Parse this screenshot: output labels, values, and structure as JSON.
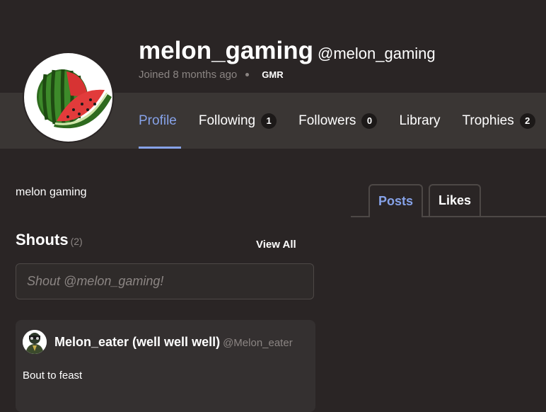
{
  "profile": {
    "display_name": "melon_gaming",
    "handle": "@melon_gaming",
    "joined": "Joined 8 months ago",
    "badge": "GMR",
    "bio": "melon gaming"
  },
  "nav": {
    "profile": "Profile",
    "following": "Following",
    "following_count": "1",
    "followers": "Followers",
    "followers_count": "0",
    "library": "Library",
    "trophies": "Trophies",
    "trophies_count": "2"
  },
  "shouts": {
    "title": "Shouts",
    "count": "(2)",
    "view_all": "View All",
    "placeholder": "Shout @melon_gaming!",
    "items": [
      {
        "author": "Melon_eater (well well well)",
        "handle": "@Melon_eater",
        "text": "Bout to feast"
      }
    ]
  },
  "feed_tabs": {
    "posts": "Posts",
    "likes": "Likes"
  },
  "colors": {
    "background": "#2a2525",
    "nav_band": "#3a3634",
    "accent": "#86a2e8",
    "muted": "#8b8583"
  },
  "icons": {
    "avatar": "watermelon-avatar",
    "shout_avatar": "user-avatar"
  }
}
